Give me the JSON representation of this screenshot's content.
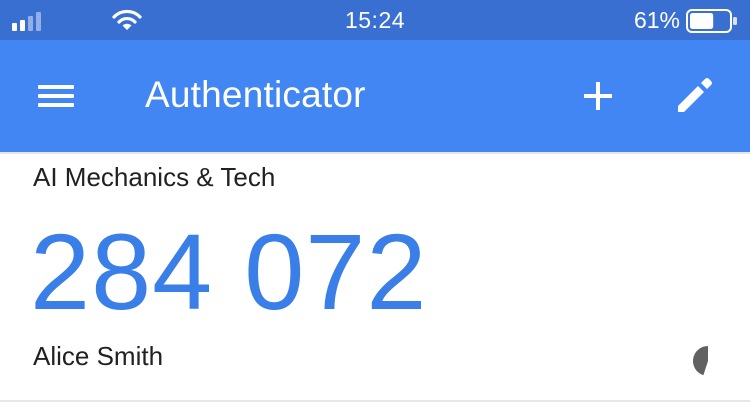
{
  "status_bar": {
    "time": "15:24",
    "battery_percent": "61%",
    "battery_level": 0.61,
    "signal_bars": 2,
    "icons": [
      "signal-icon",
      "wifi-icon",
      "battery-icon"
    ]
  },
  "app_bar": {
    "title": "Authenticator",
    "icons": [
      "menu-icon",
      "plus-icon",
      "pencil-icon"
    ],
    "color": "#4286f4"
  },
  "account": {
    "issuer": "AI Mechanics & Tech",
    "code": "284 072",
    "name": "Alice Smith",
    "code_color": "#3a7ee8",
    "timer_remaining_fraction": 0.45,
    "timer_icon": "countdown-pie-icon"
  }
}
